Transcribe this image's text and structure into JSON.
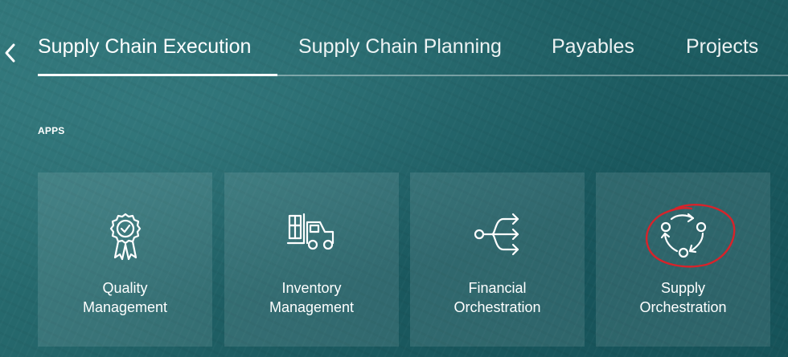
{
  "nav": {
    "tabs": [
      {
        "label": "Supply Chain Execution",
        "selected": true
      },
      {
        "label": "Supply Chain Planning",
        "selected": false
      },
      {
        "label": "Payables",
        "selected": false
      },
      {
        "label": "Projects",
        "selected": false
      }
    ]
  },
  "section": {
    "label": "APPS"
  },
  "apps": [
    {
      "line1": "Quality",
      "line2": "Management",
      "icon": "award-ribbon-icon"
    },
    {
      "line1": "Inventory",
      "line2": "Management",
      "icon": "forklift-icon"
    },
    {
      "line1": "Financial",
      "line2": "Orchestration",
      "icon": "branching-arrows-icon"
    },
    {
      "line1": "Supply",
      "line2": "Orchestration",
      "icon": "cycle-arrows-icon"
    }
  ],
  "colors": {
    "background": "#1f5f64",
    "tile": "rgba(255,255,255,0.10)",
    "annotation": "#d8232a"
  }
}
